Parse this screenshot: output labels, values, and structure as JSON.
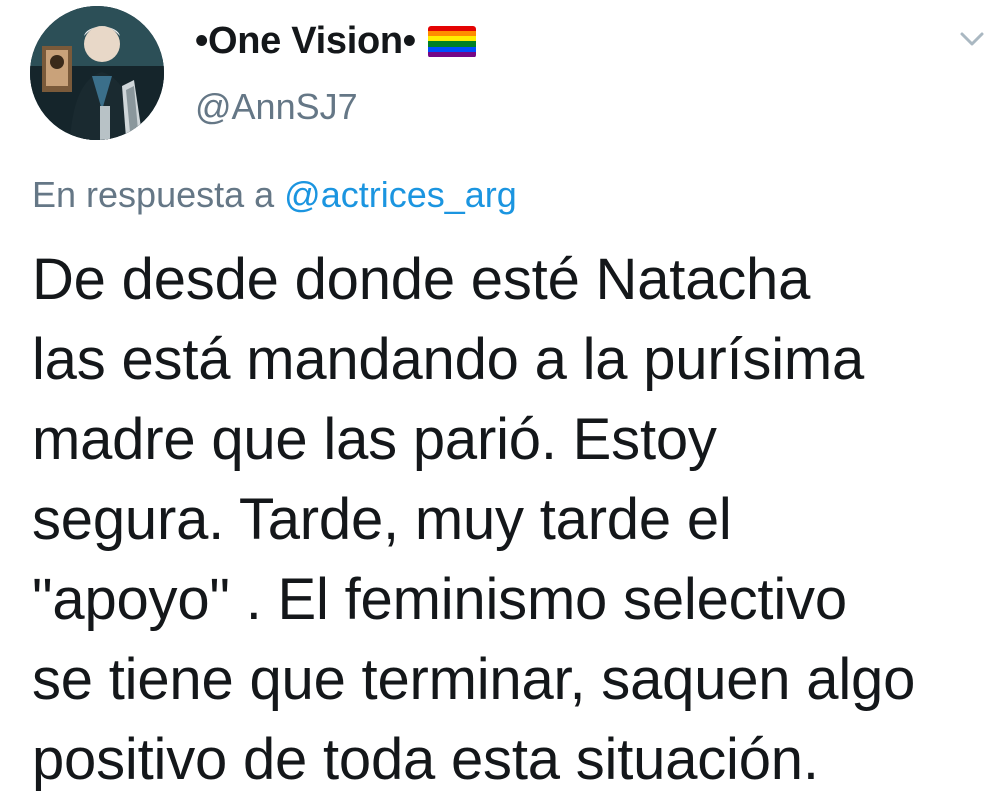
{
  "author": {
    "display_name": "•One Vision•",
    "handle": "@AnnSJ7",
    "flag_icon": "rainbow-flag-icon",
    "flag_colors": [
      "#e40303",
      "#ff8c00",
      "#ffed00",
      "#008026",
      "#004dff",
      "#750787"
    ]
  },
  "menu": {
    "icon": "chevron-down-icon",
    "color": "#aab8c2"
  },
  "reply": {
    "prefix": "En respuesta a",
    "mention": "@actrices_arg"
  },
  "tweet": {
    "lines": [
      "De desde donde esté Natacha",
      "las está mandando a la purísima",
      "madre que las parió. Estoy",
      "segura. Tarde, muy tarde el",
      "\"apoyo\" . El feminismo selectivo",
      "se tiene que terminar, saquen algo",
      "positivo de toda esta situación."
    ]
  },
  "colors": {
    "text": "#14171a",
    "secondary": "#657786",
    "link": "#1b95e0"
  }
}
